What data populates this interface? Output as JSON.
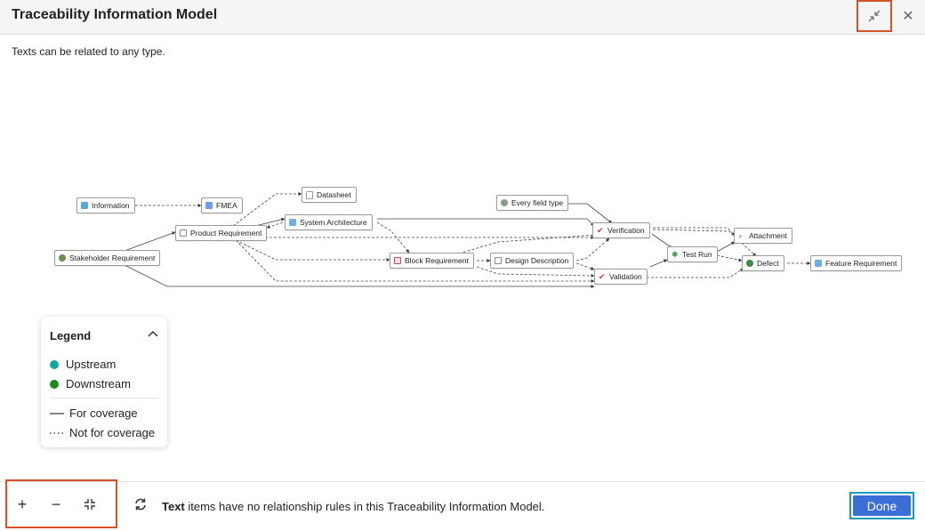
{
  "header": {
    "title": "Traceability Information Model"
  },
  "subtitle": "Texts can be related to any type.",
  "icons": {
    "collapse": "collapse-icon",
    "close": "close-icon"
  },
  "close_glyph": "✕",
  "nodes": {
    "information": "Information",
    "fmea": "FMEA",
    "datasheet": "Datasheet",
    "every_field_type": "Every field type",
    "stakeholder_requirement": "Stakeholder Requirement",
    "product_requirement": "Product Requirement",
    "system_architecture": "System Architecture",
    "block_requirement": "Block Requirement",
    "design_description": "Design Description",
    "verification": "Verification",
    "validation": "Validation",
    "test_run": "Test Run",
    "attachment": "Attachment",
    "defect": "Defect",
    "feature_requirement": "Feature Requirement"
  },
  "legend": {
    "title": "Legend",
    "upstream": "Upstream",
    "downstream": "Downstream",
    "coverage": "For coverage",
    "not_coverage": "Not for coverage",
    "upstream_color": "#16a5a5",
    "downstream_color": "#1a8a1a"
  },
  "zoom": {
    "plus": "+",
    "minus": "−"
  },
  "footer": {
    "text_bold": "Text",
    "text_rest": " items have no relationship rules in this Traceability Information Model.",
    "done": "Done"
  },
  "colors": {
    "accent": "#3b6fd6",
    "highlight": "#d4522a",
    "focus": "#1a9bb8"
  }
}
